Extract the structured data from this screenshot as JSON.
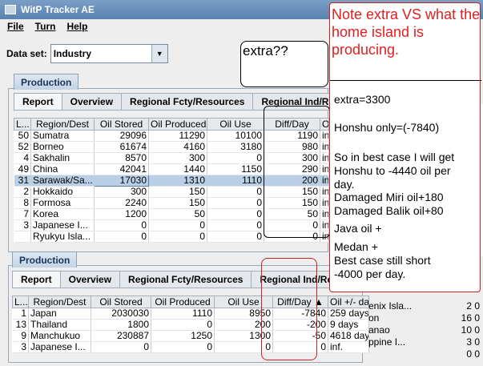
{
  "window": {
    "title": "WitP Tracker AE"
  },
  "menu": [
    "File",
    "Turn",
    "Help"
  ],
  "dataset": {
    "label": "Data set:",
    "value": "Industry"
  },
  "top_panel": {
    "tab": "Production",
    "subtabs": [
      "Report",
      "Overview",
      "Regional Fcty/Resources",
      "Regional Ind/Re"
    ],
    "columns": [
      "L...",
      "Region/Dest",
      "Oil Stored",
      "Oil Produced",
      "Oil Use",
      "Diff/Day",
      "O"
    ],
    "rows": [
      [
        "50",
        "Sumatra",
        "29096",
        "11290",
        "10100",
        "1190",
        "in"
      ],
      [
        "52",
        "Borneo",
        "61674",
        "4160",
        "3180",
        "980",
        "in"
      ],
      [
        "4",
        "Sakhalin",
        "8570",
        "300",
        "0",
        "300",
        "in"
      ],
      [
        "49",
        "China",
        "42041",
        "1440",
        "1150",
        "290",
        "in"
      ],
      [
        "31",
        "Sarawak/Sa...",
        "17030",
        "1310",
        "1110",
        "200",
        "in"
      ],
      [
        "2",
        "Hokkaido",
        "300",
        "150",
        "0",
        "150",
        "in"
      ],
      [
        "8",
        "Formosa",
        "2240",
        "150",
        "0",
        "150",
        "in"
      ],
      [
        "7",
        "Korea",
        "1200",
        "50",
        "0",
        "50",
        "in"
      ],
      [
        "3",
        "Japanese I...",
        "0",
        "0",
        "0",
        "0",
        "in"
      ],
      [
        "",
        "Ryukyu Isla...",
        "0",
        "0",
        "0",
        "0",
        "in"
      ]
    ]
  },
  "bottom_panel": {
    "tab": "Production",
    "subtabs": [
      "Report",
      "Overview",
      "Regional Fcty/Resources",
      "Regional Ind/Repa"
    ],
    "columns": [
      "L...",
      "Region/Dest",
      "Oil Stored",
      "Oil Produced",
      "Oil Use",
      "Diff/Day ▲",
      "Oil +/- days"
    ],
    "rows": [
      [
        "1",
        "Japan",
        "2030030",
        "1110",
        "8950",
        "-7840",
        "259 days"
      ],
      [
        "13",
        "Thailand",
        "1800",
        "0",
        "200",
        "-200",
        "9 days"
      ],
      [
        "9",
        "Manchukuo",
        "230887",
        "1250",
        "1300",
        "-50",
        "4618 days"
      ],
      [
        "3",
        "Japanese I...",
        "0",
        "0",
        "0",
        "0",
        "inf."
      ]
    ]
  },
  "bottom_right_rows": [
    [
      "enix Isla...",
      "2",
      "0"
    ],
    [
      "on",
      "16",
      "0"
    ],
    [
      "anao",
      "10",
      "0"
    ],
    [
      "ppine I...",
      "3",
      "0"
    ],
    [
      "",
      "0",
      "0"
    ]
  ],
  "annotations": {
    "extra_bubble": "extra??",
    "note_title": "Note extra  VS what the home island is producing.",
    "note_lines": [
      "extra=3300",
      "Honshu only=(-7840)",
      "So in best case I will get",
      "Honshu to -4440 oil per",
      "day.",
      "Damaged Miri oil+180",
      "Damaged Balik oil+80",
      "Java oil                    +",
      "Medan                     +",
      "Best case still short",
      "-4000 per day."
    ]
  },
  "colors": {
    "note_red": "#e02020",
    "titlebar": "#6a90bb"
  }
}
